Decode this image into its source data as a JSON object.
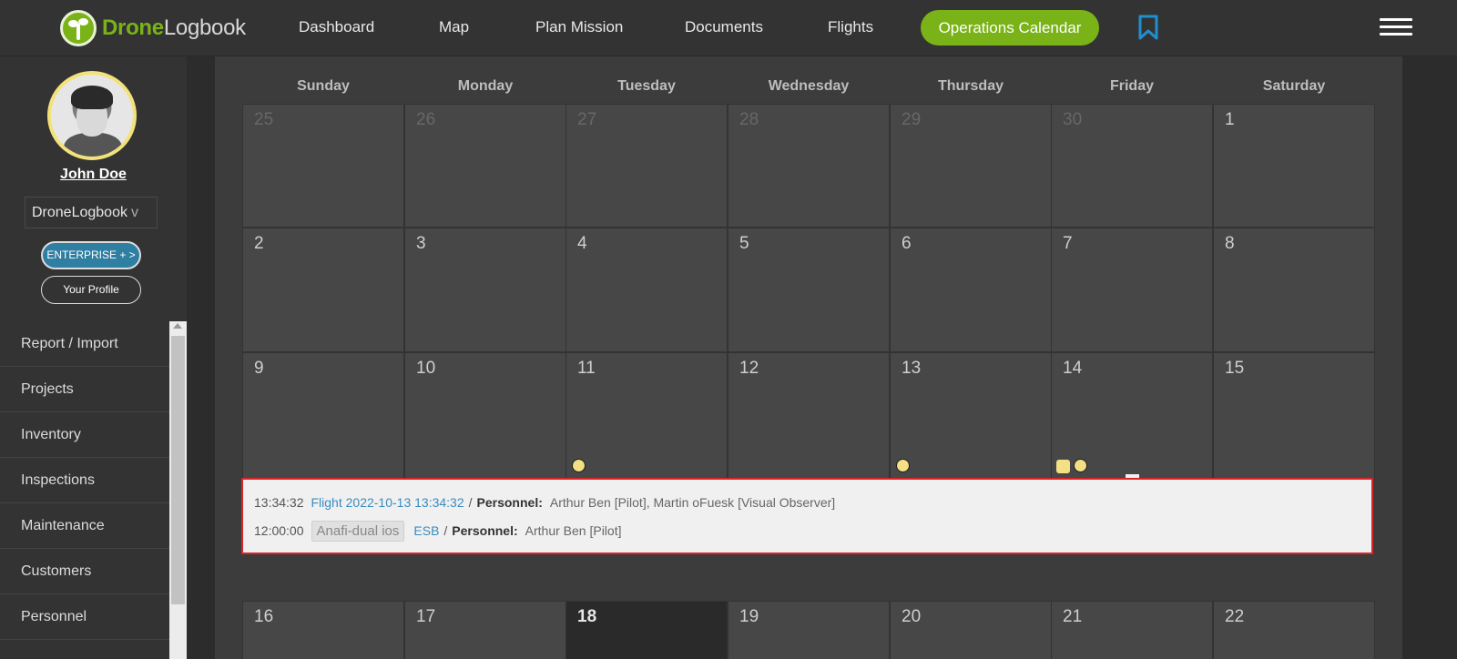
{
  "header": {
    "logo_part1": "Drone",
    "logo_part2": "Logbook",
    "nav": [
      "Dashboard",
      "Map",
      "Plan Mission",
      "Documents",
      "Flights"
    ],
    "active": "Operations Calendar",
    "bookmark_icon": "bookmark-icon",
    "menu_icon": "hamburger-icon",
    "accent": "#7ab317"
  },
  "sidebar": {
    "username": "John Doe",
    "org": "DroneLogbook",
    "org_chevron": "v",
    "enterprise": "ENTERPRISE + >",
    "profile": "Your Profile",
    "menu": [
      "Report / Import",
      "Projects",
      "Inventory",
      "Inspections",
      "Maintenance",
      "Customers",
      "Personnel"
    ]
  },
  "calendar": {
    "weekdays": [
      "Sunday",
      "Monday",
      "Tuesday",
      "Wednesday",
      "Thursday",
      "Friday",
      "Saturday"
    ],
    "weeks": [
      [
        "25",
        "26",
        "27",
        "28",
        "29",
        "30",
        "1"
      ],
      [
        "2",
        "3",
        "4",
        "5",
        "6",
        "7",
        "8"
      ],
      [
        "9",
        "10",
        "11",
        "12",
        "13",
        "14",
        "15"
      ],
      [
        "16",
        "17",
        "18",
        "19",
        "20",
        "21",
        "22"
      ]
    ],
    "today": "18"
  },
  "popup": {
    "row1": {
      "time": "13:34:32",
      "link": "Flight 2022-10-13 13:34:32",
      "sep": "/",
      "label": "Personnel:",
      "value": "Arthur Ben [Pilot], Martin oFuesk [Visual Observer]"
    },
    "row2": {
      "time": "12:00:00",
      "tag": "Anafi-dual ios",
      "link": "ESB",
      "sep": "/",
      "label": "Personnel:",
      "value": "Arthur Ben [Pilot]"
    },
    "highlight_color": "#d9252a"
  }
}
